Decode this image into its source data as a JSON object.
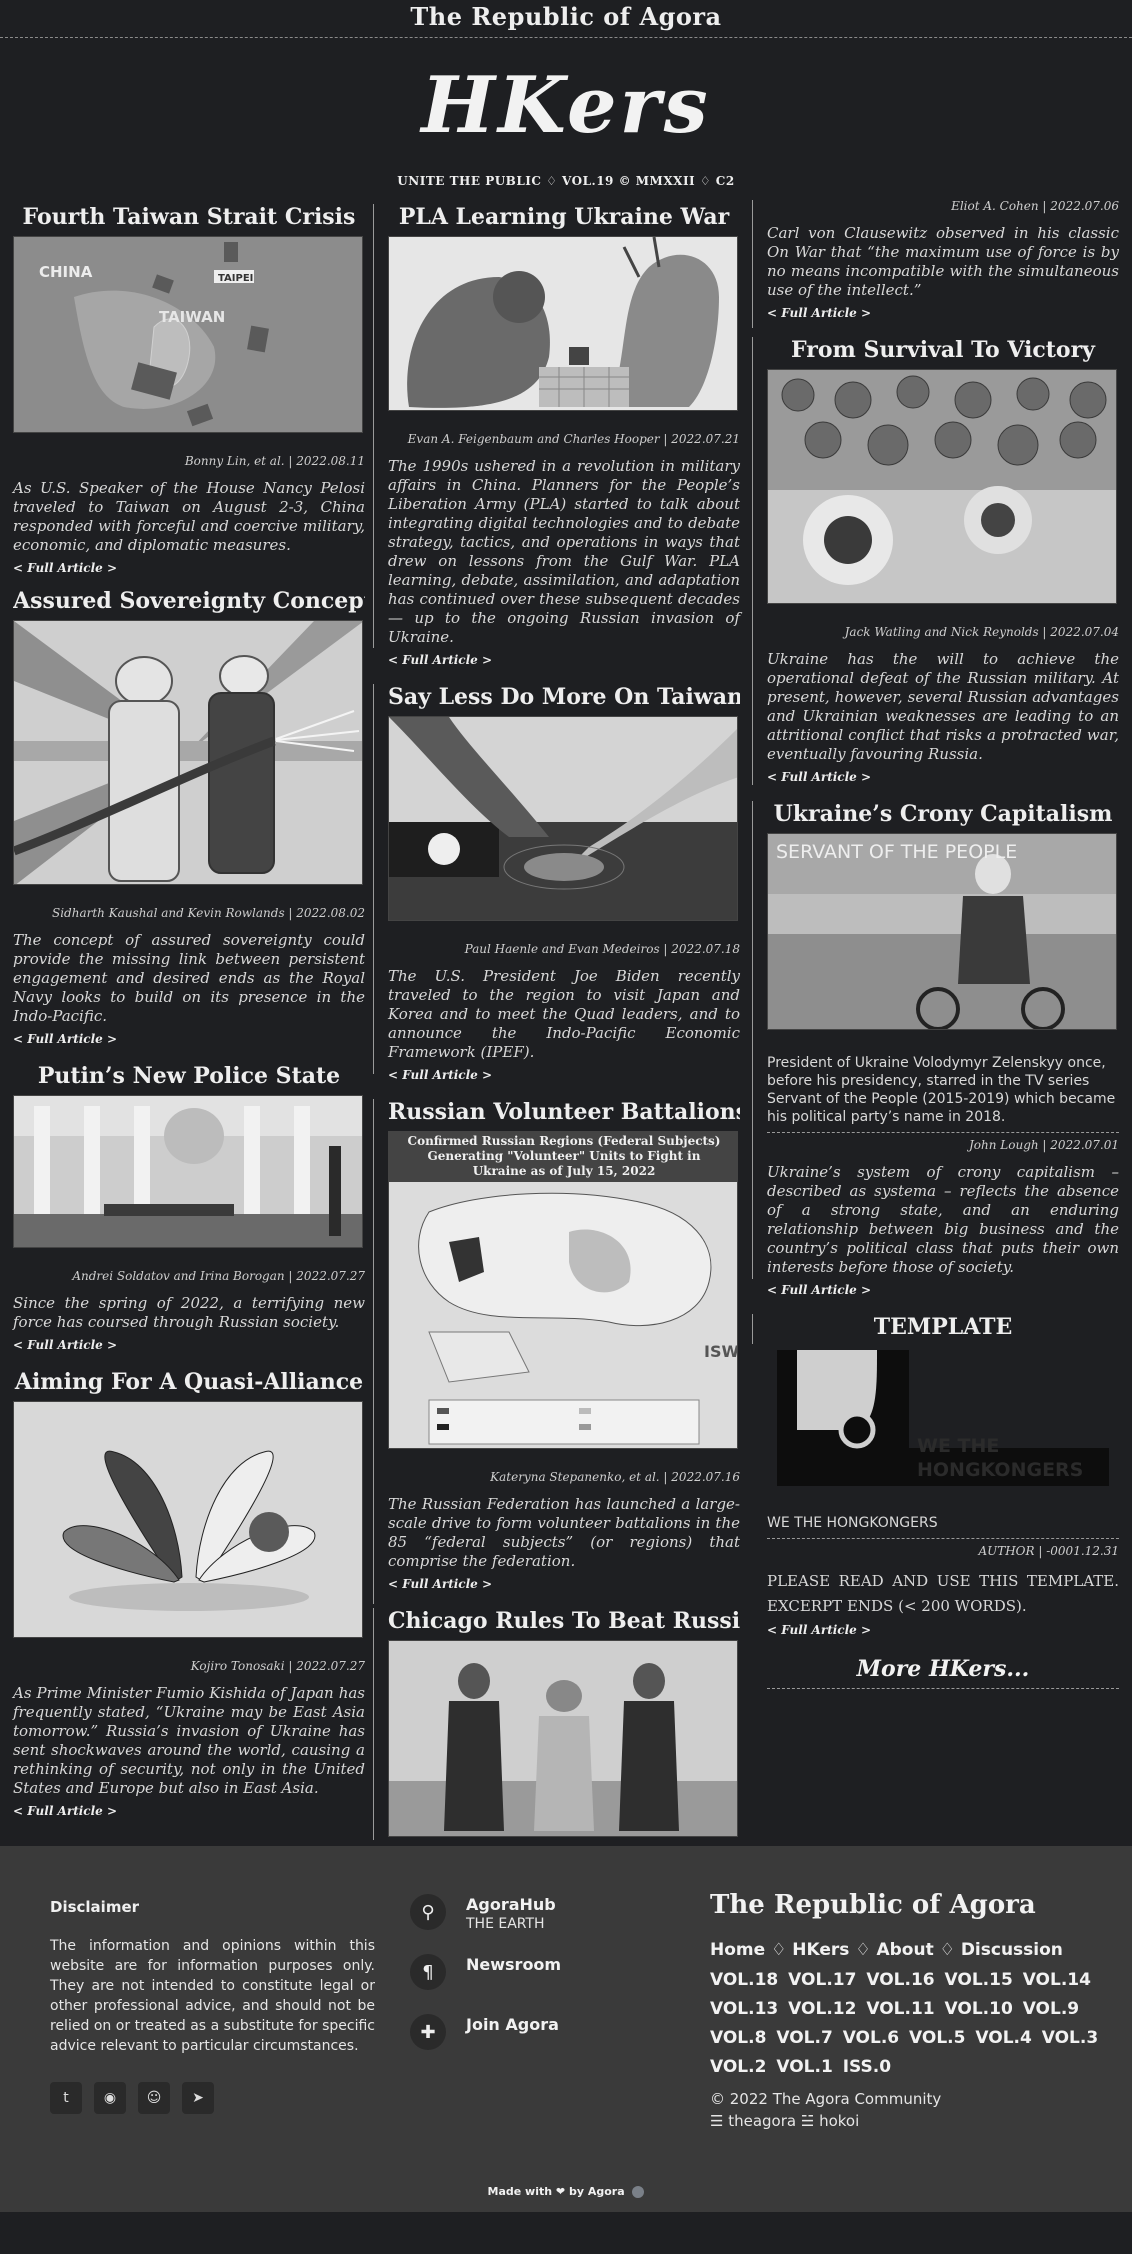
{
  "site": {
    "top_title": "The Republic of Agora",
    "logo": "HKers",
    "tagline": "UNITE THE PUBLIC ♢ VOL.19 © MMXXII ♢ C2"
  },
  "full_article_label": "< Full Article >",
  "left": [
    {
      "title": "Fourth Taiwan Strait Crisis",
      "byline": "Bonny Lin, et al. | 2022.08.11",
      "excerpt": "As U.S. Speaker of the House Nancy Pelosi traveled to Taiwan on August 2-3, China responded with forceful and coercive military, economic, and diplomatic measures.",
      "map_labels": [
        "CHINA",
        "TAIPEI",
        "TAIWAN"
      ]
    },
    {
      "title": "Assured Sovereignty Concept",
      "byline": "Sidharth Kaushal and Kevin Rowlands | 2022.08.02",
      "excerpt": "The concept of assured sovereignty could provide the missing link between persistent engagement and desired ends as the Royal Navy looks to build on its presence in the Indo-Pacific."
    },
    {
      "title": "Putin’s New Police State",
      "byline": "Andrei Soldatov and Irina Borogan | 2022.07.27",
      "excerpt": "Since the spring of 2022, a terrifying new force has coursed through Russian society."
    },
    {
      "title": "Aiming For A Quasi-Alliance",
      "byline": "Kojiro Tonosaki | 2022.07.27",
      "excerpt": "As Prime Minister Fumio Kishida of Japan has frequently stated, “Ukraine may be East Asia tomorrow.” Russia’s invasion of Ukraine has sent shockwaves around the world, causing a rethinking of security, not only in the United States and Europe but also in East Asia."
    }
  ],
  "mid": [
    {
      "title": "PLA Learning Ukraine War",
      "byline": "Evan A. Feigenbaum and Charles Hooper | 2022.07.21",
      "excerpt": "The 1990s ushered in a revolution in military affairs in China. Planners for the People’s Liberation Army (PLA) started to talk about integrating digital technologies and to debate strategy, tactics, and operations in ways that drew on lessons from the Gulf War. PLA learning, debate, assimilation, and adaptation has continued over these subsequent decades — up to the ongoing Russian invasion of Ukraine."
    },
    {
      "title": "Say Less Do More On Taiwan",
      "byline": "Paul Haenle and Evan Medeiros | 2022.07.18",
      "excerpt": "The U.S. President Joe Biden recently traveled to the region to visit Japan and Korea and to meet the Quad leaders, and to announce the Indo-Pacific Economic Framework (IPEF)."
    },
    {
      "title": "Russian Volunteer Battalions",
      "byline": "Kateryna Stepanenko, et al. | 2022.07.16",
      "excerpt": "The Russian Federation has launched a large-scale drive to form volunteer battalions in the 85 “federal subjects” (or regions) that comprise the federation.",
      "map_title": "Confirmed Russian Regions (Federal Subjects) Generating \"Volunteer\" Units to Fight in Ukraine as of July 15, 2022",
      "map_badge": "ISW"
    },
    {
      "title": "Chicago Rules To Beat Russia"
    }
  ],
  "right": [
    {
      "byline": "Eliot A. Cohen | 2022.07.06",
      "excerpt": "Carl von Clausewitz observed in his classic On War that “the maximum use of force is by no means incompatible with the simultaneous use of the intellect.”"
    },
    {
      "title": "From Survival To Victory",
      "byline": "Jack Watling and Nick Reynolds | 2022.07.04",
      "excerpt": "Ukraine has the will to achieve the operational defeat of the Russian military. At present, however, several Russian advantages and Ukrainian weaknesses are leading to an attritional conflict that risks a protracted war, eventually favouring Russia."
    },
    {
      "title": "Ukraine’s Crony Capitalism",
      "caption": "President of Ukraine Volodymyr Zelenskyy once, before his presidency, starred in the TV series Servant of the People (2015-2019) which became his political party’s name in 2018.",
      "byline": "John Lough | 2022.07.01",
      "excerpt": "Ukraine’s system of crony capitalism – described as systema – reflects the absence of a strong state, and an enduring relationship between big business and the country’s political class that puts their own interests before those of society.",
      "img_text": "SERVANT OF THE PEOPLE"
    },
    {
      "title": "TEMPLATE",
      "caption": "WE THE HONGKONGERS",
      "byline": "AUTHOR | -0001.12.31",
      "excerpt": "PLEASE READ AND USE THIS TEMPLATE. EXCERPT ENDS (< 200 WORDS).",
      "img_text": "WE THE HONGKONGERS"
    }
  ],
  "more_label": "More HKers...",
  "footer": {
    "disclaimer_title": "Disclaimer",
    "disclaimer": "The information and opinions within this website are for information purposes only. They are not intended to constitute legal or other professional advice, and should not be relied on or treated as a substitute for specific advice relevant to particular circumstances.",
    "links": [
      {
        "title": "AgoraHub",
        "sub": "THE EARTH",
        "icon": "map-pin-icon"
      },
      {
        "title": "Newsroom",
        "sub": "",
        "icon": "pilcrow-icon"
      },
      {
        "title": "Join Agora",
        "sub": "",
        "icon": "puzzle-icon"
      }
    ],
    "brand": "The Republic of Agora",
    "nav": [
      "Home",
      "HKers",
      "About",
      "Discussion"
    ],
    "nav_sep": "♢",
    "vols": "VOL.18 VOL.17 VOL.16 VOL.15 VOL.14 VOL.13 VOL.12 VOL.11 VOL.10 VOL.9 VOL.8 VOL.7 VOL.6 VOL.5 VOL.4 VOL.3 VOL.2 VOL.1 ISS.0",
    "copyright": "© 2022 The Agora Community",
    "handles": "☰ theagora ☱ hokoi",
    "made_with": "Made with ❤ by Agora"
  }
}
